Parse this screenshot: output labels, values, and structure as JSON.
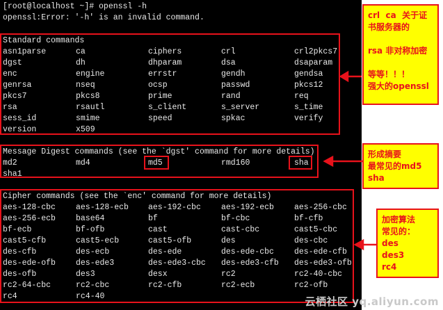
{
  "terminal": {
    "prompt_line": "[root@localhost ~]# openssl -h",
    "error_line": "openssl:Error: '-h' is an invalid command.",
    "standard": {
      "heading": "Standard commands",
      "rows": [
        [
          "asn1parse",
          "ca",
          "ciphers",
          "crl",
          "crl2pkcs7"
        ],
        [
          "dgst",
          "dh",
          "dhparam",
          "dsa",
          "dsaparam"
        ],
        [
          "enc",
          "engine",
          "errstr",
          "gendh",
          "gendsa"
        ],
        [
          "genrsa",
          "nseq",
          "ocsp",
          "passwd",
          "pkcs12"
        ],
        [
          "pkcs7",
          "pkcs8",
          "prime",
          "rand",
          "req"
        ],
        [
          "rsa",
          "rsautl",
          "s_client",
          "s_server",
          "s_time"
        ],
        [
          "sess_id",
          "smime",
          "speed",
          "spkac",
          "verify"
        ],
        [
          "version",
          "x509"
        ]
      ]
    },
    "digest": {
      "heading": "Message Digest commands (see the `dgst' command for more details)",
      "rows": [
        [
          "md2",
          "md4",
          "md5",
          "rmd160",
          "sha"
        ],
        [
          "sha1"
        ]
      ]
    },
    "cipher": {
      "heading": "Cipher commands (see the `enc' command for more details)",
      "rows": [
        [
          "aes-128-cbc",
          "aes-128-ecb",
          "aes-192-cbc",
          "aes-192-ecb",
          "aes-256-cbc"
        ],
        [
          "aes-256-ecb",
          "base64",
          "bf",
          "bf-cbc",
          "bf-cfb"
        ],
        [
          "bf-ecb",
          "bf-ofb",
          "cast",
          "cast-cbc",
          "cast5-cbc"
        ],
        [
          "cast5-cfb",
          "cast5-ecb",
          "cast5-ofb",
          "des",
          "des-cbc"
        ],
        [
          "des-cfb",
          "des-ecb",
          "des-ede",
          "des-ede-cbc",
          "des-ede-cfb"
        ],
        [
          "des-ede-ofb",
          "des-ede3",
          "des-ede3-cbc",
          "des-ede3-cfb",
          "des-ede3-ofb"
        ],
        [
          "des-ofb",
          "des3",
          "desx",
          "rc2",
          "rc2-40-cbc"
        ],
        [
          "rc2-64-cbc",
          "rc2-cbc",
          "rc2-cfb",
          "rc2-ecb",
          "rc2-ofb"
        ],
        [
          "rc4",
          "rc4-40"
        ]
      ]
    }
  },
  "annotations": {
    "standard_note": [
      "crl  ca  关于证",
      "书服务器的",
      "",
      "rsa 非对称加密",
      "",
      "等等！！！",
      "强大的openssl"
    ],
    "digest_note": [
      "形成摘要",
      "最常见的md5",
      "sha"
    ],
    "cipher_note": [
      "加密算法",
      "常见的：",
      "des",
      "des3",
      "rc4"
    ]
  },
  "watermark": "云栖社区 yq.aliyun.com",
  "colors": {
    "highlight": "#e8121b",
    "note_bg": "#ffff00",
    "terminal_bg": "#000000",
    "terminal_fg": "#e8e8e8"
  }
}
